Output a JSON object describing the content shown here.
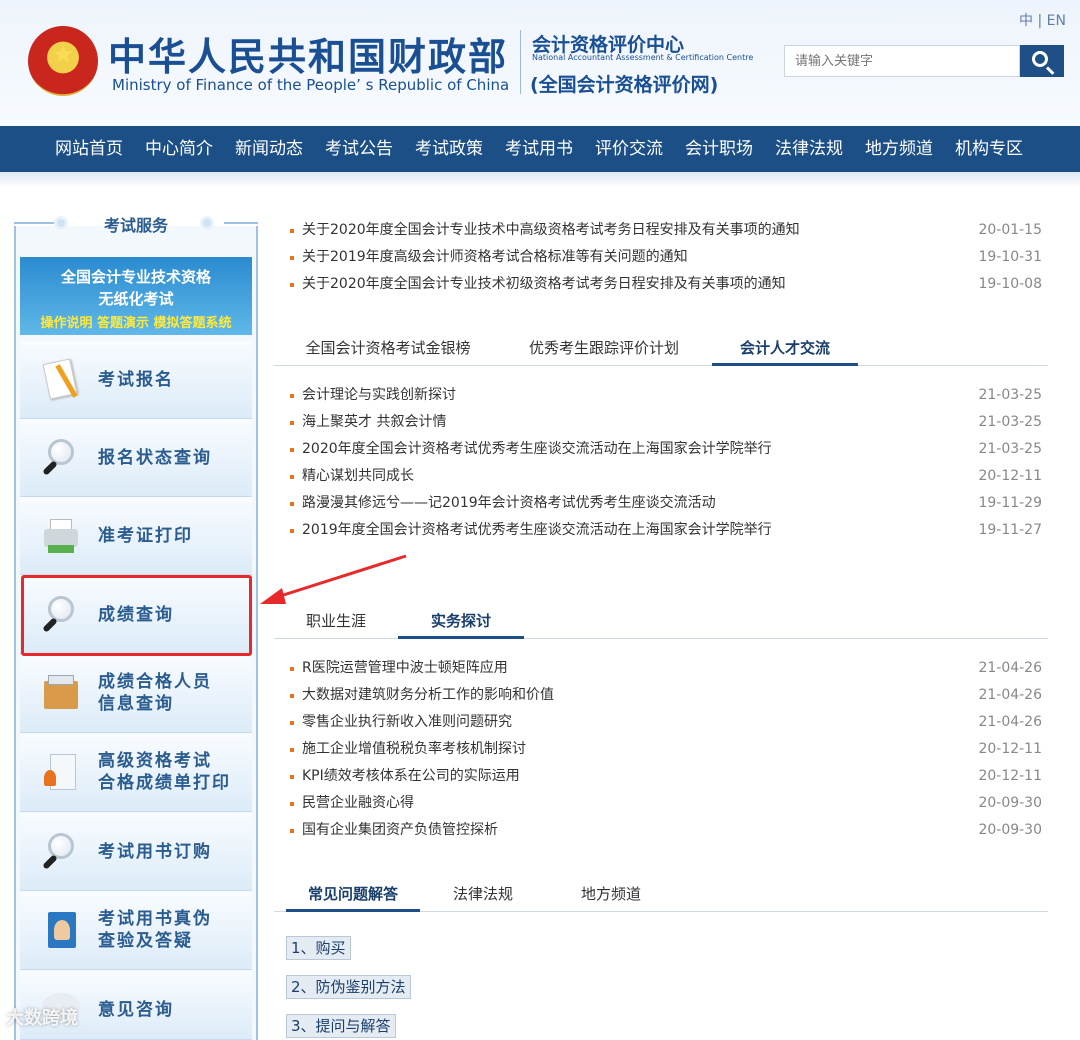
{
  "header": {
    "site_title": "中华人民共和国财政部",
    "site_subtitle": "Ministry of Finance of the People’ s Republic of China",
    "center_cn": "会计资格评价中心",
    "center_en": "National Accountant Assessment & Certification Centre",
    "center_net": "(全国会计资格评价网)",
    "lang_zh": "中",
    "lang_sep": "|",
    "lang_en": "EN",
    "search_placeholder": "请输入关键字"
  },
  "nav": [
    "网站首页",
    "中心简介",
    "新闻动态",
    "考试公告",
    "考试政策",
    "考试用书",
    "评价交流",
    "会计职场",
    "法律法规",
    "地方频道",
    "机构专区"
  ],
  "sidebar": {
    "heading": "考试服务",
    "banner": {
      "line1": "全国会计专业技术资格",
      "line2": "无纸化考试",
      "line3": "操作说明 答题演示 模拟答题系统"
    },
    "items": [
      {
        "lines": [
          "考试报名"
        ],
        "icon": "exam-registration-icon"
      },
      {
        "lines": [
          "报名状态查询"
        ],
        "icon": "magnifier-icon"
      },
      {
        "lines": [
          "准考证打印"
        ],
        "icon": "printer-icon"
      },
      {
        "lines": [
          "成绩查询"
        ],
        "icon": "magnifier-icon"
      },
      {
        "lines": [
          "成绩合格人员",
          "信息查询"
        ],
        "icon": "file-box-icon"
      },
      {
        "lines": [
          "高级资格考试",
          "合格成绩单打印"
        ],
        "icon": "certificate-icon"
      },
      {
        "lines": [
          "考试用书订购"
        ],
        "icon": "magnifier-icon"
      },
      {
        "lines": [
          "考试用书真伪",
          "查验及答疑"
        ],
        "icon": "book-icon"
      },
      {
        "lines": [
          "意见咨询"
        ],
        "icon": "chat-bubble-icon"
      }
    ]
  },
  "top_news": [
    {
      "title": "关于2020年度全国会计专业技术中高级资格考试考务日程安排及有关事项的通知",
      "date": "20-01-15"
    },
    {
      "title": "关于2019年度高级会计师资格考试合格标准等有关问题的通知",
      "date": "19-10-31"
    },
    {
      "title": "关于2020年度全国会计专业技术初级资格考试考务日程安排及有关事项的通知",
      "date": "19-10-08"
    }
  ],
  "section1": {
    "tabs": [
      "全国会计资格考试金银榜",
      "优秀考生跟踪评价计划",
      "会计人才交流"
    ],
    "active": 2,
    "news": [
      {
        "title": "会计理论与实践创新探讨",
        "date": "21-03-25"
      },
      {
        "title": "海上聚英才 共叙会计情",
        "date": "21-03-25"
      },
      {
        "title": "2020年度全国会计资格考试优秀考生座谈交流活动在上海国家会计学院举行",
        "date": "21-03-25"
      },
      {
        "title": "精心谋划共同成长",
        "date": "20-12-11"
      },
      {
        "title": "路漫漫其修远兮——记2019年会计资格考试优秀考生座谈交流活动",
        "date": "19-11-29"
      },
      {
        "title": "2019年度全国会计资格考试优秀考生座谈交流活动在上海国家会计学院举行",
        "date": "19-11-27"
      }
    ]
  },
  "section2": {
    "tabs": [
      "职业生涯",
      "实务探讨"
    ],
    "active": 1,
    "news": [
      {
        "title": "R医院运营管理中波士顿矩阵应用",
        "date": "21-04-26"
      },
      {
        "title": "大数据对建筑财务分析工作的影响和价值",
        "date": "21-04-26"
      },
      {
        "title": "零售企业执行新收入准则问题研究",
        "date": "21-04-26"
      },
      {
        "title": "施工企业增值税税负率考核机制探讨",
        "date": "20-12-11"
      },
      {
        "title": "KPI绩效考核体系在公司的实际运用",
        "date": "20-12-11"
      },
      {
        "title": "民营企业融资心得",
        "date": "20-09-30"
      },
      {
        "title": "国有企业集团资产负债管控探析",
        "date": "20-09-30"
      }
    ]
  },
  "section3": {
    "tabs": [
      "常见问题解答",
      "法律法规",
      "地方频道"
    ],
    "active": 0,
    "faq": [
      "1、购买",
      "2、防伪鉴别方法",
      "3、提问与解答"
    ]
  },
  "watermark": "大数跨境",
  "colors": {
    "nav_bg": "#1b4f85",
    "accent": "#e8731d",
    "highlight": "#e8292c"
  }
}
